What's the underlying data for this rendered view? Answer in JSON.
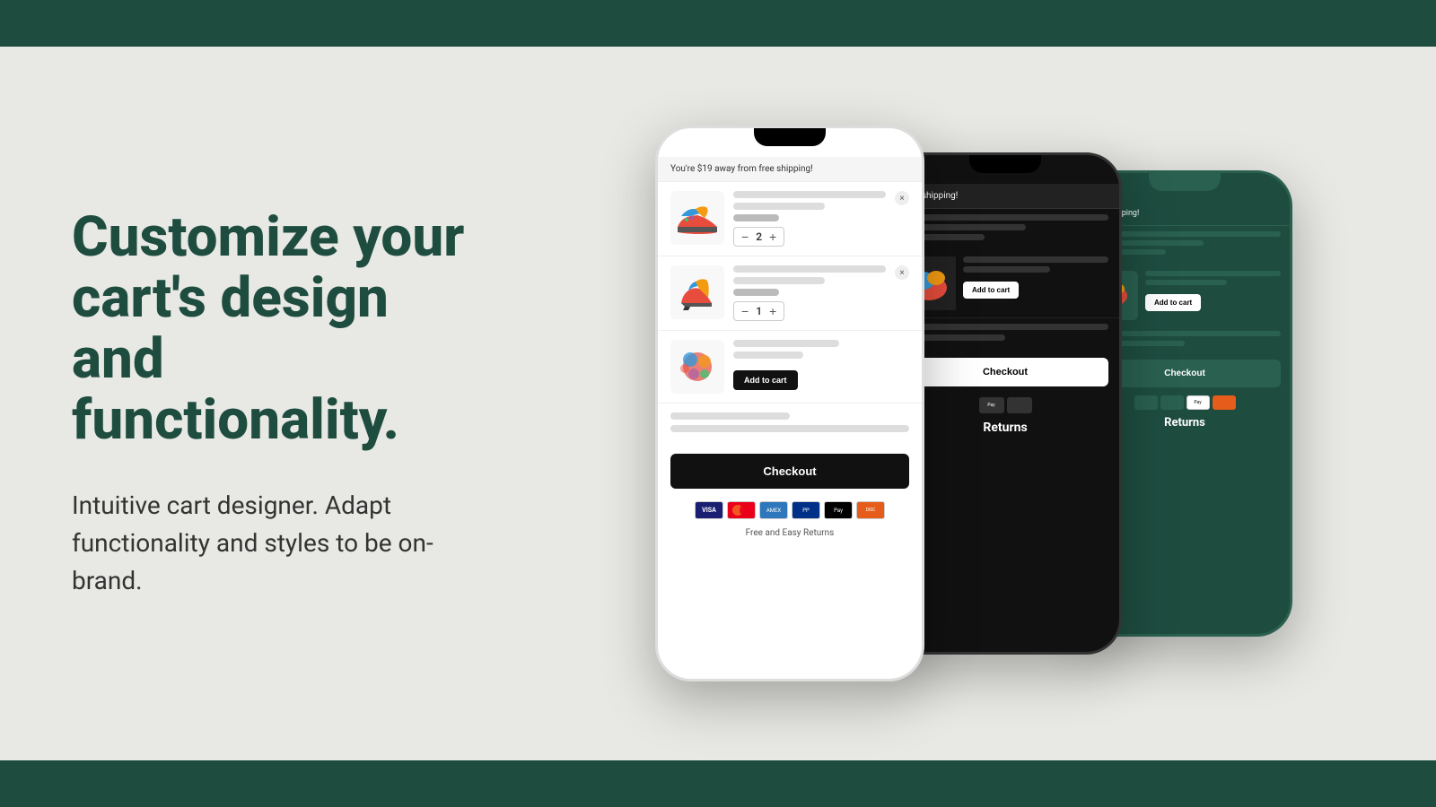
{
  "topBar": {
    "color": "#1e4d40"
  },
  "bottomBar": {
    "color": "#1e4d40"
  },
  "headline": "Customize your cart's design and functionality.",
  "subtext": "Intuitive cart designer. Adapt functionality and styles to be on-brand.",
  "phoneFront": {
    "shippingBanner": "You're $19 away from free shipping!",
    "item1": {
      "qty": 2
    },
    "item2": {
      "qty": 1
    },
    "item3": {
      "addToCart": "Add to cart"
    },
    "checkoutBtn": "Checkout",
    "returnsText": "Free and Easy Returns"
  },
  "phoneMid": {
    "shippingBanner": "free shipping!",
    "addToCartBtn": "Add to cart",
    "returnsText": "Returns"
  },
  "phoneBack": {
    "shippingBanner": "free shipping!",
    "addToCartBtn": "Add to cart",
    "returnsText": "Returns"
  }
}
